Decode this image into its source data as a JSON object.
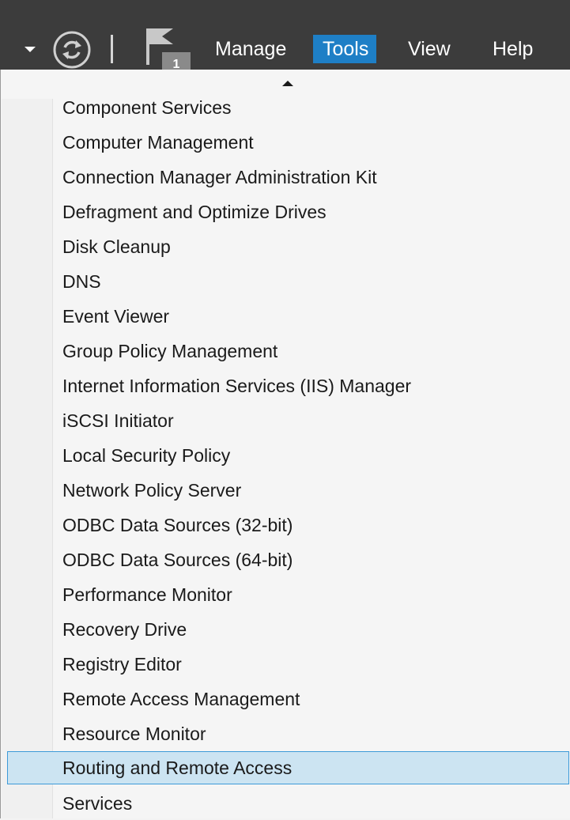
{
  "menubar": {
    "manage_label": "Manage",
    "tools_label": "Tools",
    "view_label": "View",
    "help_label": "Help",
    "notification_count": "1",
    "active_menu": "Tools",
    "active_color": "#1e7fc6"
  },
  "icons": {
    "dropdown": "chevron-down-icon",
    "refresh": "refresh-icon",
    "notifications": "flag-icon",
    "scroll_up": "scroll-up-arrow-icon"
  },
  "tools_menu": {
    "items": [
      {
        "label": "Component Services"
      },
      {
        "label": "Computer Management"
      },
      {
        "label": "Connection Manager Administration Kit"
      },
      {
        "label": "Defragment and Optimize Drives"
      },
      {
        "label": "Disk Cleanup"
      },
      {
        "label": "DNS"
      },
      {
        "label": "Event Viewer"
      },
      {
        "label": "Group Policy Management"
      },
      {
        "label": "Internet Information Services (IIS) Manager"
      },
      {
        "label": "iSCSI Initiator"
      },
      {
        "label": "Local Security Policy"
      },
      {
        "label": "Network Policy Server"
      },
      {
        "label": "ODBC Data Sources (32-bit)"
      },
      {
        "label": "ODBC Data Sources (64-bit)"
      },
      {
        "label": "Performance Monitor"
      },
      {
        "label": "Recovery Drive"
      },
      {
        "label": "Registry Editor"
      },
      {
        "label": "Remote Access Management"
      },
      {
        "label": "Resource Monitor"
      },
      {
        "label": "Routing and Remote Access"
      },
      {
        "label": "Services"
      }
    ],
    "highlighted_item": "Routing and Remote Access",
    "highlight_color": "#cce4f2"
  }
}
